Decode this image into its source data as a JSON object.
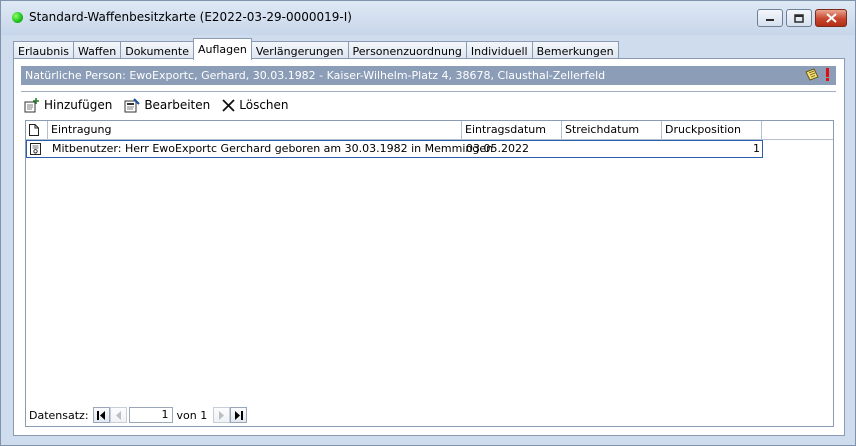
{
  "window": {
    "title": "Standard-Waffenbesitzkarte (E2022-03-29-0000019-I)",
    "status_color": "#22c022"
  },
  "tabs": [
    {
      "label": "Erlaubnis"
    },
    {
      "label": "Waffen"
    },
    {
      "label": "Dokumente"
    },
    {
      "label": "Auflagen",
      "active": true
    },
    {
      "label": "Verlängerungen"
    },
    {
      "label": "Personenzuordnung"
    },
    {
      "label": "Individuell"
    },
    {
      "label": "Bemerkungen"
    }
  ],
  "person_bar": {
    "text": "Natürliche Person: EwoExportc, Gerhard, 30.03.1982 - Kaiser-Wilhelm-Platz 4, 38678, Clausthal-Zellerfeld"
  },
  "toolbar": {
    "add_label": "Hinzufügen",
    "edit_label": "Bearbeiten",
    "delete_label": "Löschen"
  },
  "table": {
    "columns": [
      "Eintragung",
      "Eintragsdatum",
      "Streichdatum",
      "Druckposition"
    ],
    "rows": [
      {
        "eintragung": "Mitbenutzer: Herr EwoExportc Gerchard geboren am 30.03.1982 in Memmingen",
        "eintragsdatum": "03.05.2022",
        "streichdatum": "",
        "druckposition": "1"
      }
    ]
  },
  "navigator": {
    "label": "Datensatz:",
    "current": "1",
    "of_label": "von 1"
  },
  "colors": {
    "person_bar_bg": "#8c9db8",
    "selection_border": "#2b5fae",
    "window_bg": "#cfdcee"
  }
}
